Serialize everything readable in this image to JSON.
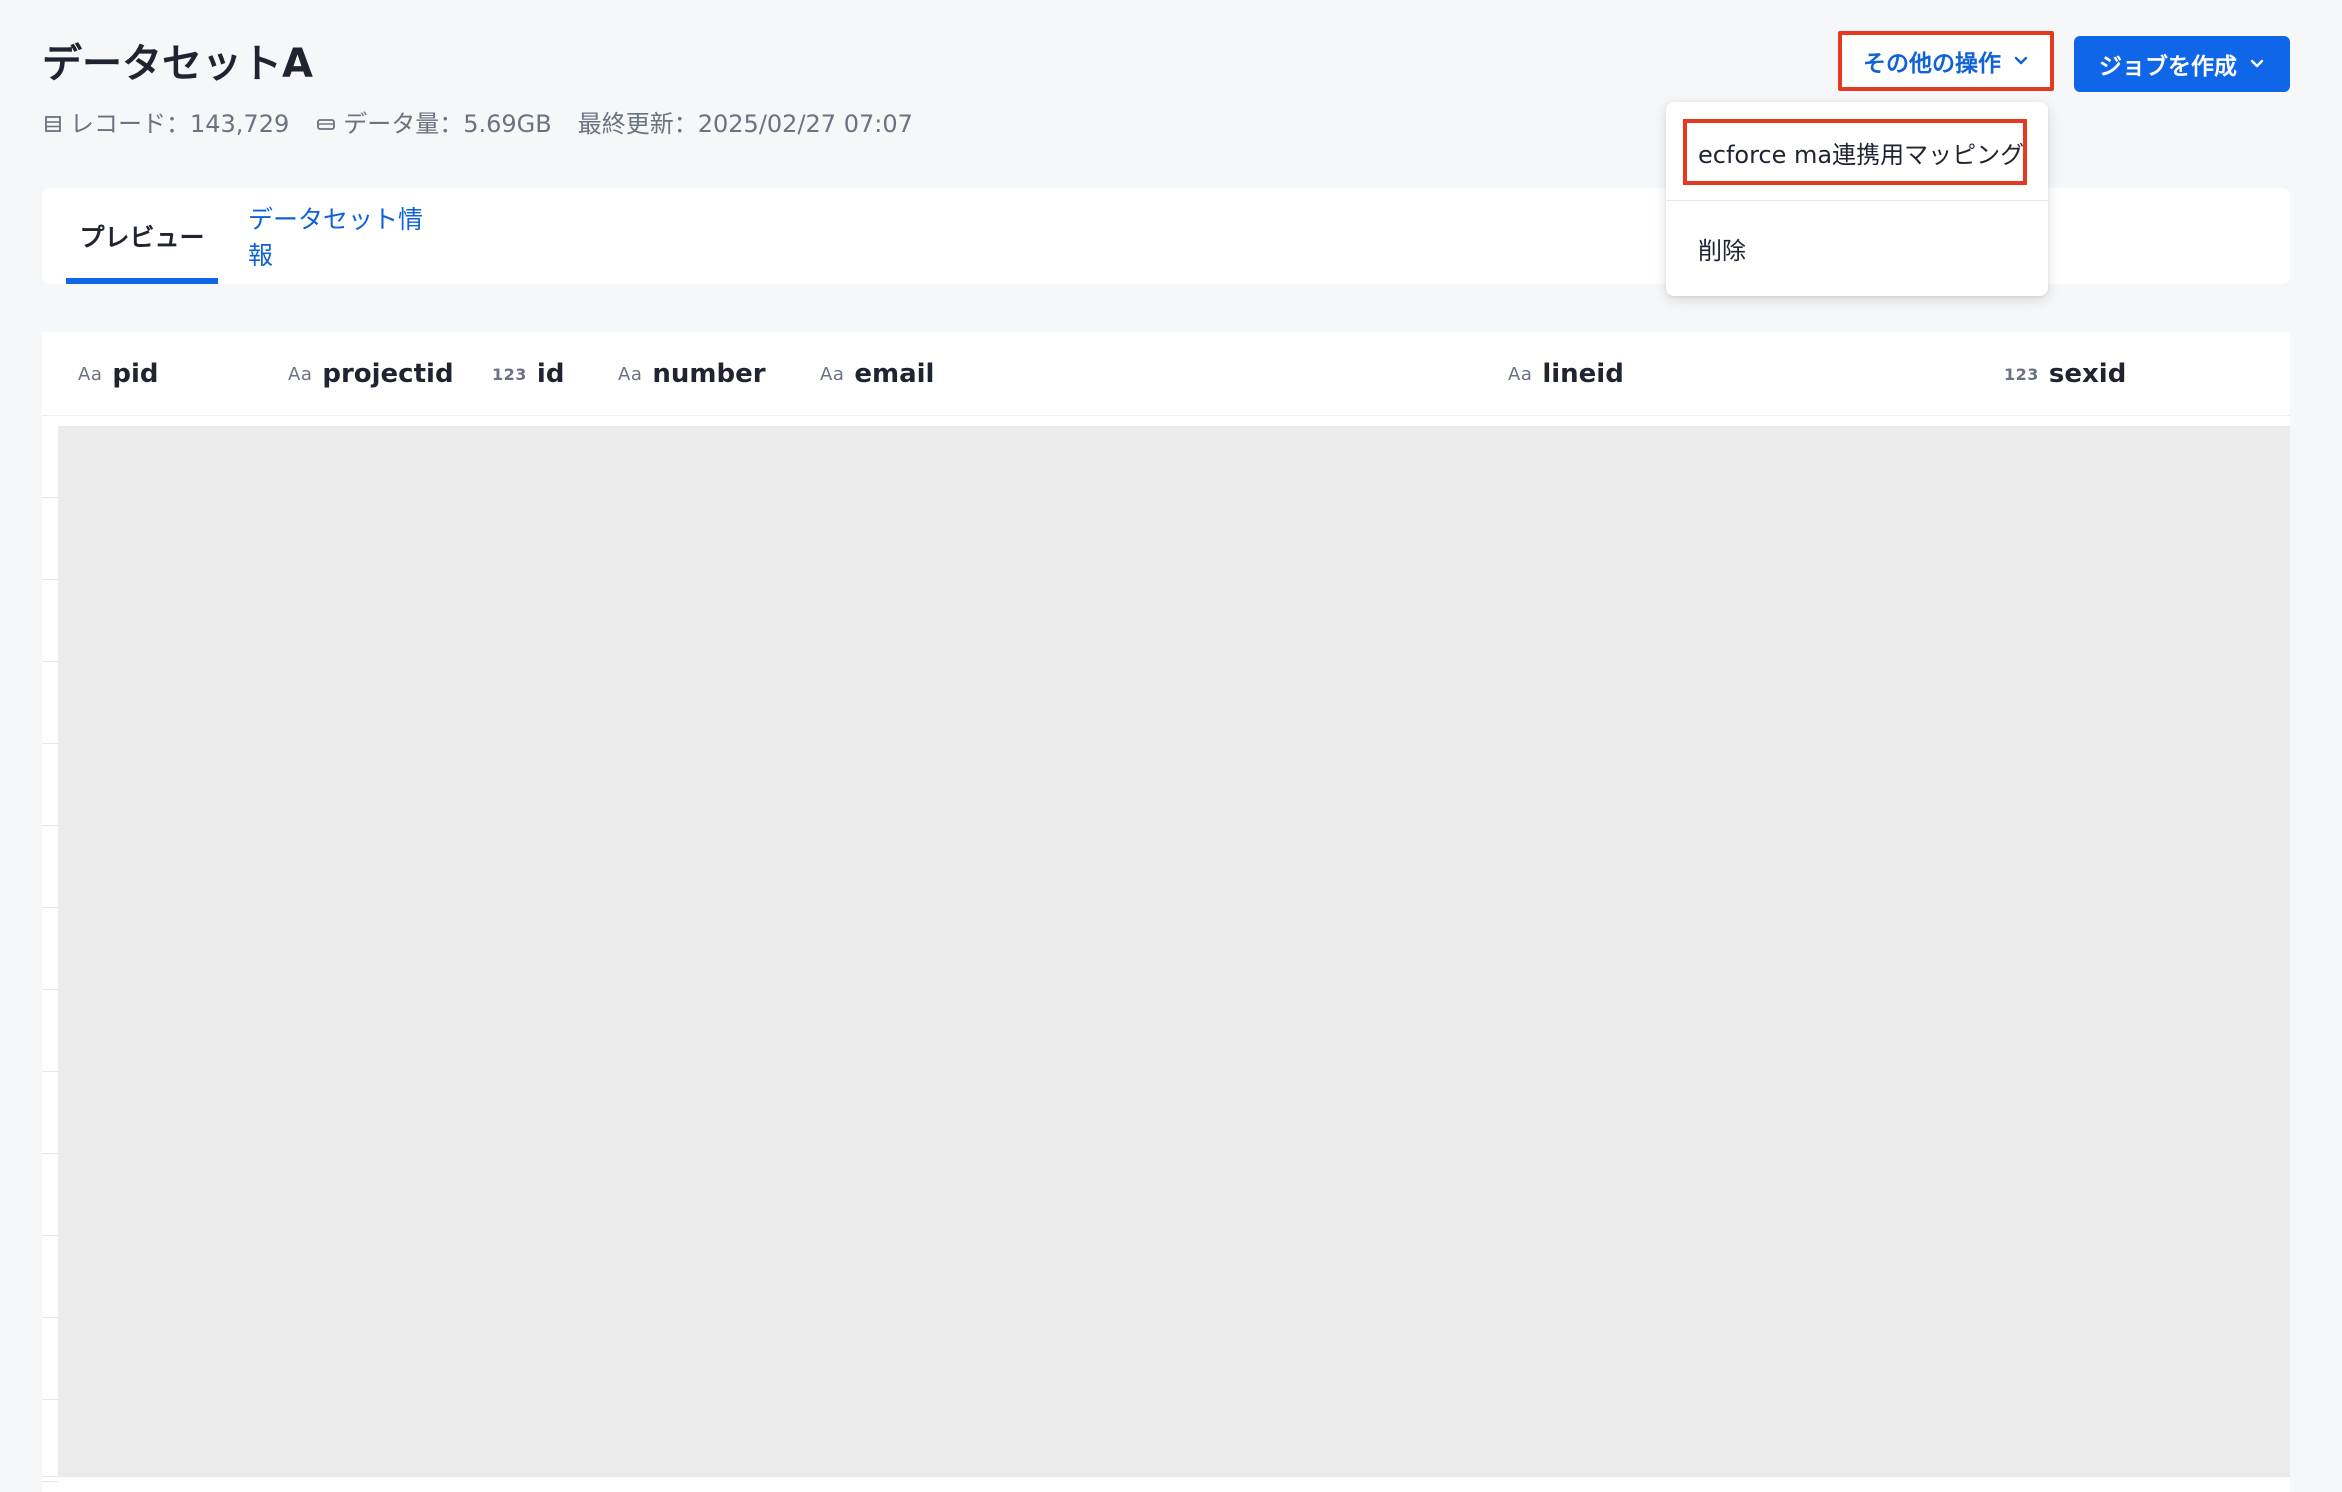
{
  "dataset": {
    "title": "データセットA",
    "meta": {
      "records": "レコード：143,729",
      "data_size": "データ量：5.69GB",
      "last_updated": "最終更新：2025/02/27 07:07"
    }
  },
  "actions": {
    "other_actions_label": "その他の操作",
    "create_job_label": "ジョブを作成",
    "accent_color": "#0f66e8",
    "highlight_color": "#e53a1f"
  },
  "dropdown": {
    "items": [
      {
        "label": "ecforce ma連携用マッピング"
      },
      {
        "label": "削除"
      }
    ]
  },
  "tabs": [
    {
      "label": "プレビュー",
      "active": true
    },
    {
      "label": "データセット情報",
      "active": false
    }
  ],
  "table": {
    "columns": [
      {
        "type_icon": "Aa",
        "name": "pid"
      },
      {
        "type_icon": "Aa",
        "name": "projectid"
      },
      {
        "type_icon": "123",
        "name": "id"
      },
      {
        "type_icon": "Aa",
        "name": "number"
      },
      {
        "type_icon": "Aa",
        "name": "email"
      },
      {
        "type_icon": "Aa",
        "name": "lineid"
      },
      {
        "type_icon": "123",
        "name": "sexid"
      }
    ]
  }
}
